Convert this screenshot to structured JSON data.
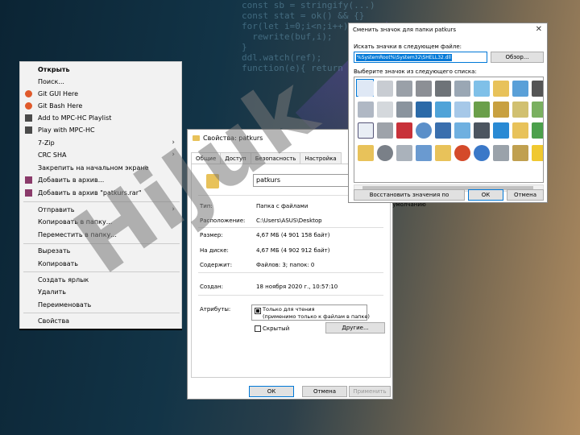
{
  "context_menu": {
    "items": [
      {
        "label": "Открыть",
        "bold": true
      },
      {
        "label": "Поиск..."
      },
      {
        "label": "Git GUI Here"
      },
      {
        "label": "Git Bash Here"
      },
      {
        "label": "Add to MPC-HC Playlist"
      },
      {
        "label": "Play with MPC-HC"
      },
      {
        "label": "7-Zip"
      },
      {
        "label": "CRC SHA"
      },
      {
        "label": "Закрепить на начальном экране"
      },
      {
        "label": "Добавить в архив..."
      },
      {
        "label": "Добавить в архив \"patkurs.rar\""
      },
      {
        "label": "Отправить"
      },
      {
        "label": "Копировать в папку..."
      },
      {
        "label": "Переместить в папку..."
      },
      {
        "label": "Вырезать"
      },
      {
        "label": "Копировать"
      },
      {
        "label": "Создать ярлык"
      },
      {
        "label": "Удалить"
      },
      {
        "label": "Переименовать"
      },
      {
        "label": "Свойства"
      }
    ]
  },
  "properties": {
    "title": "Свойства: patkurs",
    "tabs": [
      "Общие",
      "Доступ",
      "Безопасность",
      "Настройка"
    ],
    "name": "patkurs",
    "rows": [
      {
        "label": "Тип:",
        "value": "Папка с файлами"
      },
      {
        "label": "Расположение:",
        "value": "C:\\Users\\ASUS\\Desktop"
      },
      {
        "label": "Размер:",
        "value": "4,67 МБ (4 901 158 байт)"
      },
      {
        "label": "На диске:",
        "value": "4,67 МБ (4 902 912 байт)"
      },
      {
        "label": "Содержит:",
        "value": "Файлов: 3; папок: 0"
      },
      {
        "label": "Создан:",
        "value": "18 ноября 2020 г., 10:57:10"
      }
    ],
    "attributes_label": "Атрибуты:",
    "readonly_label": "Только для чтения",
    "readonly_sub": "(применимо только к файлам в папке)",
    "hidden_label": "Скрытый",
    "other_button": "Другие...",
    "ok": "ОК",
    "cancel": "Отмена",
    "apply": "Применить"
  },
  "icon_dialog": {
    "title": "Сменить значок для папки patkurs",
    "search_label": "Искать значки в следующем файле:",
    "path_value": "%SystemRoot%\\System32\\SHELL32.dll",
    "browse": "Обзор...",
    "list_label": "Выберите значок из следующего списка:",
    "restore": "Восстановить значения по умолчанию",
    "ok": "ОК",
    "cancel": "Отмена"
  },
  "watermark": "HiJuk"
}
